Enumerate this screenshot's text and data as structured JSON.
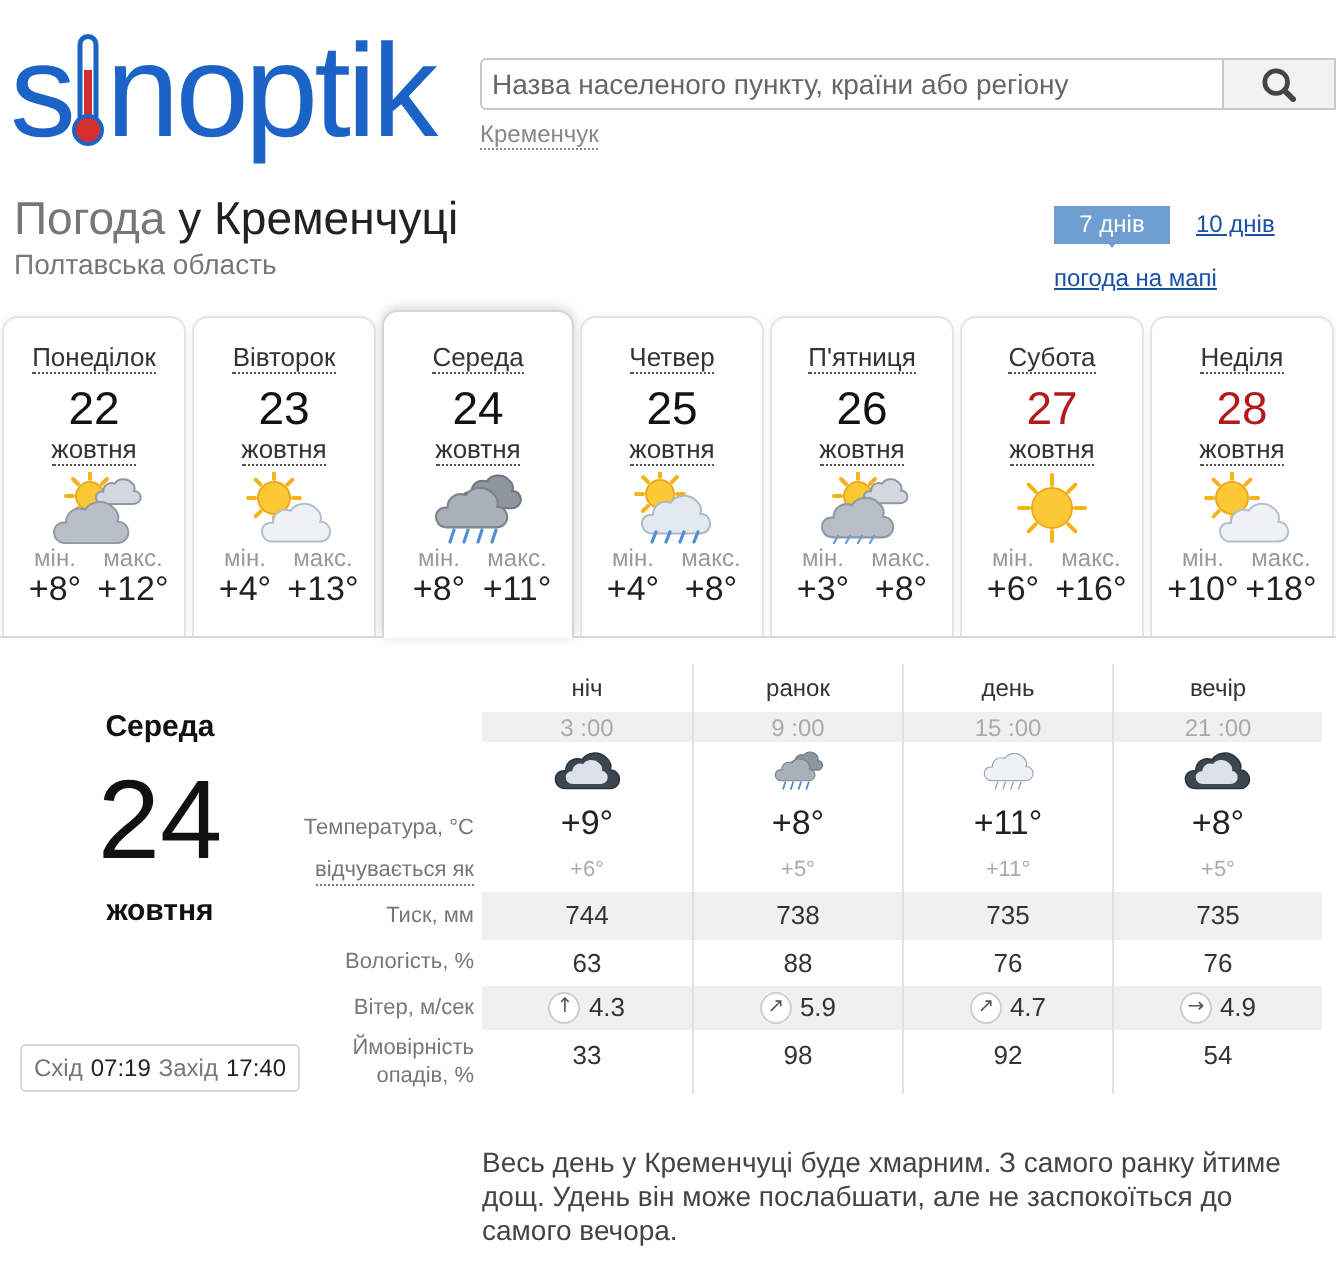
{
  "logo": {
    "text_start": "s",
    "text_end": "noptik"
  },
  "search": {
    "placeholder": "Назва населеного пункту, країни або регіону",
    "recent": "Кременчук"
  },
  "heading": {
    "prefix": "Погода",
    "city": "у Кременчуці",
    "region": "Полтавська область"
  },
  "range_tabs": [
    {
      "label": "7 днів",
      "selected": true
    },
    {
      "label": "10 днів",
      "selected": false
    }
  ],
  "map_link": "погода на мапі",
  "days": [
    {
      "weekday": "Понеділок",
      "date": "22",
      "month": "жовтня",
      "kind": "cloudy",
      "min_label": "мін.",
      "min": "+8°",
      "max_label": "макс.",
      "max": "+12°",
      "weekend": false,
      "selected": false
    },
    {
      "weekday": "Вівторок",
      "date": "23",
      "month": "жовтня",
      "kind": "partly",
      "min_label": "мін.",
      "min": "+4°",
      "max_label": "макс.",
      "max": "+13°",
      "weekend": false,
      "selected": false
    },
    {
      "weekday": "Середа",
      "date": "24",
      "month": "жовтня",
      "kind": "rain",
      "min_label": "мін.",
      "min": "+8°",
      "max_label": "макс.",
      "max": "+11°",
      "weekend": false,
      "selected": true
    },
    {
      "weekday": "Четвер",
      "date": "25",
      "month": "жовтня",
      "kind": "showers",
      "min_label": "мін.",
      "min": "+4°",
      "max_label": "макс.",
      "max": "+8°",
      "weekend": false,
      "selected": false
    },
    {
      "weekday": "П'ятниця",
      "date": "26",
      "month": "жовтня",
      "kind": "drizzle",
      "min_label": "мін.",
      "min": "+3°",
      "max_label": "макс.",
      "max": "+8°",
      "weekend": false,
      "selected": false
    },
    {
      "weekday": "Субота",
      "date": "27",
      "month": "жовтня",
      "kind": "sunny",
      "min_label": "мін.",
      "min": "+6°",
      "max_label": "макс.",
      "max": "+16°",
      "weekend": true,
      "selected": false
    },
    {
      "weekday": "Неділя",
      "date": "28",
      "month": "жовтня",
      "kind": "partly",
      "min_label": "мін.",
      "min": "+10°",
      "max_label": "макс.",
      "max": "+18°",
      "weekend": true,
      "selected": false
    }
  ],
  "detail": {
    "weekday": "Середа",
    "date": "24",
    "month": "жовтня",
    "sun": [
      {
        "label": "Схід",
        "time": "07:19"
      },
      {
        "label": "Захід",
        "time": "17:40"
      }
    ],
    "labels": {
      "temperature": "Температура, °C",
      "feels_like": "відчувається як",
      "pressure": "Тиск, мм",
      "humidity": "Вологість, %",
      "wind": "Вітер, м/сек",
      "precipitation": "Ймовірність опадів, %"
    },
    "periods": [
      {
        "name": "ніч",
        "time": "3 :00",
        "kind": "overcast",
        "temperature": "+9°",
        "feels_like": "+6°",
        "pressure": "744",
        "humidity": "63",
        "wind_arrow": "↑",
        "wind": "4.3",
        "precipitation": "33"
      },
      {
        "name": "ранок",
        "time": "9 :00",
        "kind": "rain",
        "temperature": "+8°",
        "feels_like": "+5°",
        "pressure": "738",
        "humidity": "88",
        "wind_arrow": "↗",
        "wind": "5.9",
        "precipitation": "98"
      },
      {
        "name": "день",
        "time": "15 :00",
        "kind": "lightrain",
        "temperature": "+11°",
        "feels_like": "+11°",
        "pressure": "735",
        "humidity": "76",
        "wind_arrow": "↗",
        "wind": "4.7",
        "precipitation": "92"
      },
      {
        "name": "вечір",
        "time": "21 :00",
        "kind": "overcast",
        "temperature": "+8°",
        "feels_like": "+5°",
        "pressure": "735",
        "humidity": "76",
        "wind_arrow": "→",
        "wind": "4.9",
        "precipitation": "54"
      }
    ]
  },
  "summary": "Весь день у Кременчуці буде хмарним. З самого ранку йтиме дощ. Удень він може послабшати, але не заспокоїться до самого вечора."
}
